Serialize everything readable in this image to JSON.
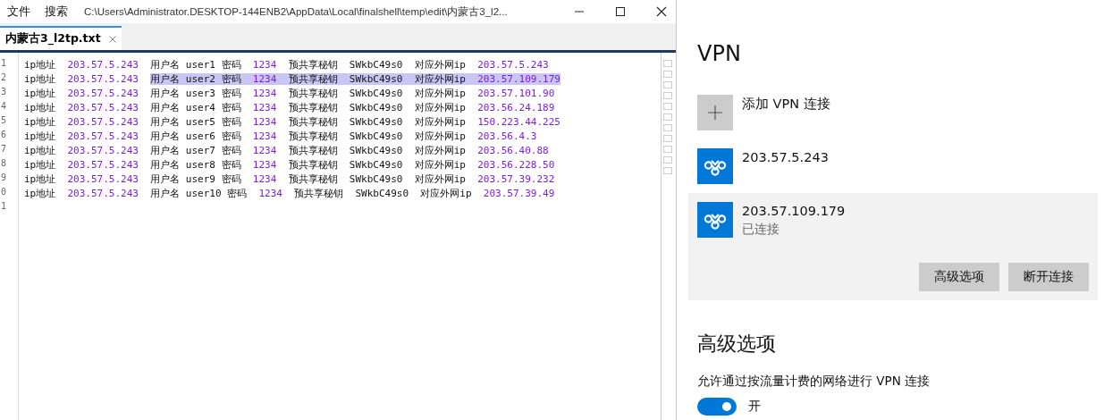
{
  "window": {
    "menu": [
      "文件",
      "搜索"
    ],
    "path": "C:\\Users\\Administrator.DESKTOP-144ENB2\\AppData\\Local\\finalshell\\temp\\edit\\内蒙古3_l2..."
  },
  "tabs": [
    {
      "label": "内蒙古3_l2tp.txt",
      "selected": true
    }
  ],
  "editor": {
    "lines": [
      {
        "number": "1",
        "tokens": [
          {
            "text": "ip地址",
            "kind": "text",
            "selected": false
          },
          {
            "text": "203.57.5.243",
            "kind": "value",
            "selected": false
          },
          {
            "text": "用户名 user1 密码",
            "kind": "text",
            "selected": false
          },
          {
            "text": "1234",
            "kind": "value",
            "selected": false
          },
          {
            "text": "预共享秘钥",
            "kind": "text",
            "selected": false
          },
          {
            "text": "SWkbC49s0",
            "kind": "text",
            "selected": false
          },
          {
            "text": "对应外网ip",
            "kind": "text",
            "selected": false
          },
          {
            "text": "203.57.5.243",
            "kind": "value",
            "selected": false
          }
        ]
      },
      {
        "number": "2",
        "tokens": [
          {
            "text": "ip地址",
            "kind": "text",
            "selected": false
          },
          {
            "text": "203.57.5.243",
            "kind": "value",
            "selected": false
          },
          {
            "text": "用户名 user2 密码",
            "kind": "text",
            "selected": true
          },
          {
            "text": "1234",
            "kind": "value",
            "selected": true
          },
          {
            "text": "预共享秘钥",
            "kind": "text",
            "selected": true
          },
          {
            "text": "SWkbC49s0",
            "kind": "text",
            "selected": true
          },
          {
            "text": "对应外网ip",
            "kind": "text",
            "selected": true
          },
          {
            "text": "203.57.109.179",
            "kind": "value",
            "selected": true
          }
        ]
      },
      {
        "number": "3",
        "tokens": [
          {
            "text": "ip地址",
            "kind": "text",
            "selected": false
          },
          {
            "text": "203.57.5.243",
            "kind": "value",
            "selected": false
          },
          {
            "text": "用户名 user3 密码",
            "kind": "text",
            "selected": false
          },
          {
            "text": "1234",
            "kind": "value",
            "selected": false
          },
          {
            "text": "预共享秘钥",
            "kind": "text",
            "selected": false
          },
          {
            "text": "SWkbC49s0",
            "kind": "text",
            "selected": false
          },
          {
            "text": "对应外网ip",
            "kind": "text",
            "selected": false
          },
          {
            "text": "203.57.101.90",
            "kind": "value",
            "selected": false
          }
        ]
      },
      {
        "number": "4",
        "tokens": [
          {
            "text": "ip地址",
            "kind": "text",
            "selected": false
          },
          {
            "text": "203.57.5.243",
            "kind": "value",
            "selected": false
          },
          {
            "text": "用户名 user4 密码",
            "kind": "text",
            "selected": false
          },
          {
            "text": "1234",
            "kind": "value",
            "selected": false
          },
          {
            "text": "预共享秘钥",
            "kind": "text",
            "selected": false
          },
          {
            "text": "SWkbC49s0",
            "kind": "text",
            "selected": false
          },
          {
            "text": "对应外网ip",
            "kind": "text",
            "selected": false
          },
          {
            "text": "203.56.24.189",
            "kind": "value",
            "selected": false
          }
        ]
      },
      {
        "number": "5",
        "tokens": [
          {
            "text": "ip地址",
            "kind": "text",
            "selected": false
          },
          {
            "text": "203.57.5.243",
            "kind": "value",
            "selected": false
          },
          {
            "text": "用户名 user5 密码",
            "kind": "text",
            "selected": false
          },
          {
            "text": "1234",
            "kind": "value",
            "selected": false
          },
          {
            "text": "预共享秘钥",
            "kind": "text",
            "selected": false
          },
          {
            "text": "SWkbC49s0",
            "kind": "text",
            "selected": false
          },
          {
            "text": "对应外网ip",
            "kind": "text",
            "selected": false
          },
          {
            "text": "150.223.44.225",
            "kind": "value",
            "selected": false
          }
        ]
      },
      {
        "number": "6",
        "tokens": [
          {
            "text": "ip地址",
            "kind": "text",
            "selected": false
          },
          {
            "text": "203.57.5.243",
            "kind": "value",
            "selected": false
          },
          {
            "text": "用户名 user6 密码",
            "kind": "text",
            "selected": false
          },
          {
            "text": "1234",
            "kind": "value",
            "selected": false
          },
          {
            "text": "预共享秘钥",
            "kind": "text",
            "selected": false
          },
          {
            "text": "SWkbC49s0",
            "kind": "text",
            "selected": false
          },
          {
            "text": "对应外网ip",
            "kind": "text",
            "selected": false
          },
          {
            "text": "203.56.4.3",
            "kind": "value",
            "selected": false
          }
        ]
      },
      {
        "number": "7",
        "tokens": [
          {
            "text": "ip地址",
            "kind": "text",
            "selected": false
          },
          {
            "text": "203.57.5.243",
            "kind": "value",
            "selected": false
          },
          {
            "text": "用户名 user7 密码",
            "kind": "text",
            "selected": false
          },
          {
            "text": "1234",
            "kind": "value",
            "selected": false
          },
          {
            "text": "预共享秘钥",
            "kind": "text",
            "selected": false
          },
          {
            "text": "SWkbC49s0",
            "kind": "text",
            "selected": false
          },
          {
            "text": "对应外网ip",
            "kind": "text",
            "selected": false
          },
          {
            "text": "203.56.40.88",
            "kind": "value",
            "selected": false
          }
        ]
      },
      {
        "number": "8",
        "tokens": [
          {
            "text": "ip地址",
            "kind": "text",
            "selected": false
          },
          {
            "text": "203.57.5.243",
            "kind": "value",
            "selected": false
          },
          {
            "text": "用户名 user8 密码",
            "kind": "text",
            "selected": false
          },
          {
            "text": "1234",
            "kind": "value",
            "selected": false
          },
          {
            "text": "预共享秘钥",
            "kind": "text",
            "selected": false
          },
          {
            "text": "SWkbC49s0",
            "kind": "text",
            "selected": false
          },
          {
            "text": "对应外网ip",
            "kind": "text",
            "selected": false
          },
          {
            "text": "203.56.228.50",
            "kind": "value",
            "selected": false
          }
        ]
      },
      {
        "number": "9",
        "tokens": [
          {
            "text": "ip地址",
            "kind": "text",
            "selected": false
          },
          {
            "text": "203.57.5.243",
            "kind": "value",
            "selected": false
          },
          {
            "text": "用户名 user9 密码",
            "kind": "text",
            "selected": false
          },
          {
            "text": "1234",
            "kind": "value",
            "selected": false
          },
          {
            "text": "预共享秘钥",
            "kind": "text",
            "selected": false
          },
          {
            "text": "SWkbC49s0",
            "kind": "text",
            "selected": false
          },
          {
            "text": "对应外网ip",
            "kind": "text",
            "selected": false
          },
          {
            "text": "203.57.39.232",
            "kind": "value",
            "selected": false
          }
        ]
      },
      {
        "number": "0",
        "tokens": [
          {
            "text": "ip地址",
            "kind": "text",
            "selected": false
          },
          {
            "text": "203.57.5.243",
            "kind": "value",
            "selected": false
          },
          {
            "text": "用户名 user10 密码",
            "kind": "text",
            "selected": false
          },
          {
            "text": "1234",
            "kind": "value",
            "selected": false
          },
          {
            "text": "预共享秘钥",
            "kind": "text",
            "selected": false
          },
          {
            "text": "SWkbC49s0",
            "kind": "text",
            "selected": false
          },
          {
            "text": "对应外网ip",
            "kind": "text",
            "selected": false
          },
          {
            "text": "203.57.39.49",
            "kind": "value",
            "selected": false
          }
        ]
      },
      {
        "number": "1"
      }
    ]
  },
  "vpn": {
    "title": "VPN",
    "items": [
      {
        "kind": "add",
        "label": "添加 VPN 连接",
        "selected": false
      },
      {
        "kind": "connection",
        "label": "203.57.5.243",
        "selected": false
      },
      {
        "kind": "connection",
        "label": "203.57.109.179",
        "status": "已连接",
        "selected": true,
        "buttons": [
          "高级选项",
          "断开连接"
        ]
      }
    ]
  },
  "advanced": {
    "heading": "高级选项",
    "setting": {
      "label": "允许通过按流量计费的网络进行 VPN 连接",
      "on": true,
      "state_label": "开"
    }
  }
}
